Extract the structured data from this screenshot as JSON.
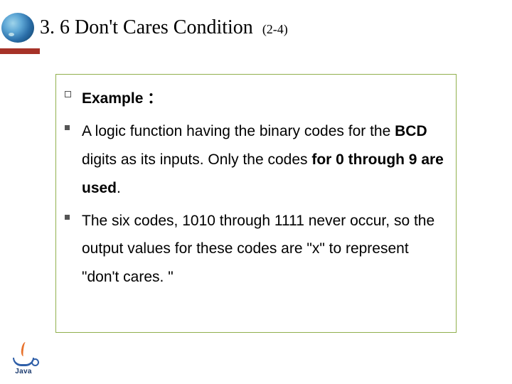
{
  "header": {
    "title_main": "3. 6 Don't Cares Condition",
    "title_sub": "(2-4)"
  },
  "content": {
    "example_label": "Example ：",
    "bullet1_part1": "A logic function having the binary codes for the ",
    "bullet1_bold1": "BCD",
    "bullet1_part2": " digits as its inputs. Only the codes ",
    "bullet1_bold2": "for 0 through 9 are used",
    "bullet1_part3": ".",
    "bullet2": "The six codes, 1010 through 1111 never occur, so the output values for these codes are \"x\" to represent \"don't cares. \""
  },
  "footer": {
    "java_label": "Java"
  }
}
